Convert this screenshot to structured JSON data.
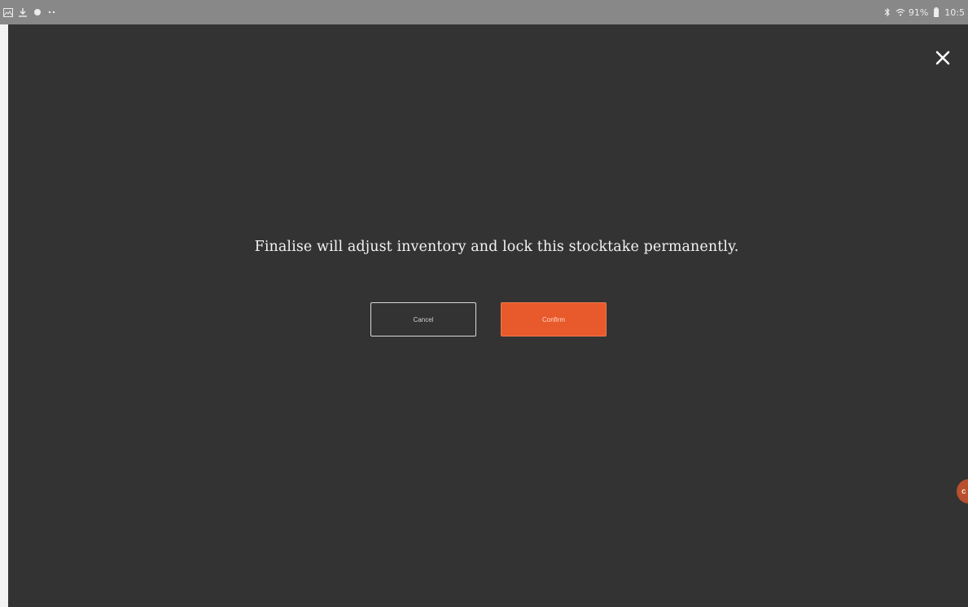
{
  "status_bar": {
    "left_icons": [
      "image-icon",
      "download-icon",
      "notification-dot-icon",
      "more-dots-icon"
    ],
    "right_icons": [
      "bluetooth-icon",
      "wifi-icon",
      "battery-icon"
    ],
    "battery_text": "91%",
    "time_text": "10:5"
  },
  "dialog": {
    "close_icon": "close-icon",
    "message": "Finalise will adjust inventory and lock this stocktake permanently.",
    "cancel_label": "Cancel",
    "confirm_label": "Confirm"
  },
  "fab": {
    "label": "c"
  },
  "colors": {
    "status_bar": "#888888",
    "overlay": "#333333",
    "accent": "#e8592b",
    "fab": "#b94f2e"
  }
}
